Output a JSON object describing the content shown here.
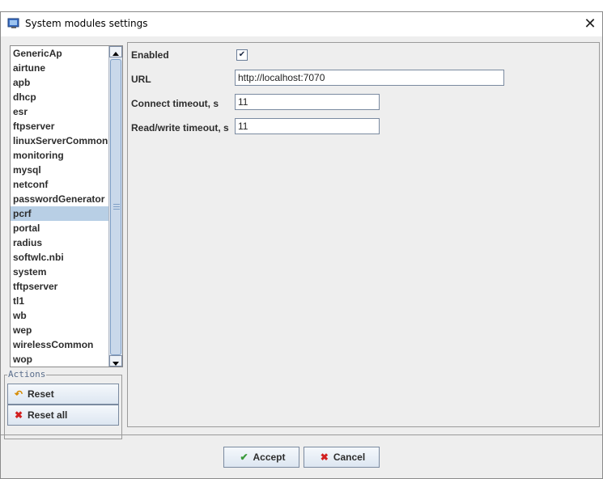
{
  "window": {
    "title": "System modules settings"
  },
  "modules": [
    "GenericAp",
    "airtune",
    "apb",
    "dhcp",
    "esr",
    "ftpserver",
    "linuxServerCommon",
    "monitoring",
    "mysql",
    "netconf",
    "passwordGenerator",
    "pcrf",
    "portal",
    "radius",
    "softwlc.nbi",
    "system",
    "tftpserver",
    "tl1",
    "wb",
    "wep",
    "wirelessCommon",
    "wop"
  ],
  "selected_module": "pcrf",
  "actions": {
    "label": "Actions",
    "reset": "Reset",
    "reset_all": "Reset all"
  },
  "form": {
    "enabled_label": "Enabled",
    "enabled_mark": "✔",
    "url_label": "URL",
    "url_value": "http://localhost:7070",
    "connect_label": "Connect timeout, s",
    "connect_value": "11",
    "rw_label": "Read/write timeout, s",
    "rw_value": "11"
  },
  "buttons": {
    "accept": "Accept",
    "cancel": "Cancel"
  },
  "colors": {
    "selection": "#b8cfe5",
    "accept_icon": "#3a9a3a",
    "cancel_icon": "#d22020"
  }
}
